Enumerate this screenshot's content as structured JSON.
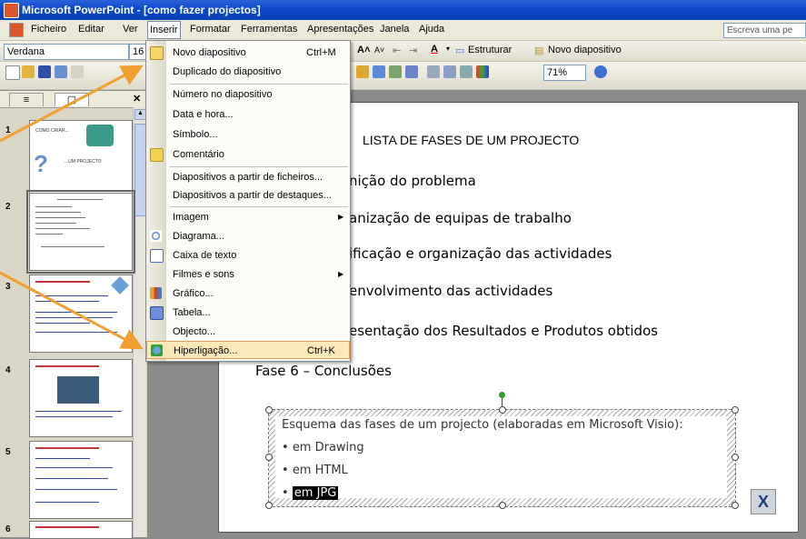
{
  "window": {
    "title": "Microsoft PowerPoint - [como fazer projectos]"
  },
  "menubar": {
    "items": [
      "Ficheiro",
      "Editar",
      "Ver",
      "Inserir",
      "Formatar",
      "Ferramentas",
      "Apresentações",
      "Janela",
      "Ajuda"
    ],
    "help_placeholder": "Escreva uma pe"
  },
  "format_toolbar": {
    "font": "Verdana",
    "size": "16",
    "structure_label": "Estruturar",
    "new_slide_label": "Novo diapositivo"
  },
  "standard_toolbar": {
    "zoom": "71%"
  },
  "slide_thumbnails": {
    "numbers": [
      "1",
      "2",
      "3",
      "4",
      "5",
      "6"
    ],
    "thumb1_title": "COMO CRIAR...",
    "thumb1_subtitle": "...UM PROJECTO"
  },
  "insert_menu": {
    "items": [
      {
        "label": "Novo diapositivo",
        "shortcut": "Ctrl+M"
      },
      {
        "label": "Duplicado do diapositivo",
        "shortcut": ""
      },
      {
        "label": "Número no diapositivo",
        "shortcut": ""
      },
      {
        "label": "Data e hora...",
        "shortcut": ""
      },
      {
        "label": "Símbolo...",
        "shortcut": ""
      },
      {
        "label": "Comentário",
        "shortcut": ""
      },
      {
        "label": "Diapositivos a partir de ficheiros...",
        "shortcut": ""
      },
      {
        "label": "Diapositivos a partir de destaques...",
        "shortcut": ""
      },
      {
        "label": "Imagem",
        "shortcut": ""
      },
      {
        "label": "Diagrama...",
        "shortcut": ""
      },
      {
        "label": "Caixa de texto",
        "shortcut": ""
      },
      {
        "label": "Filmes e sons",
        "shortcut": ""
      },
      {
        "label": "Gráfico...",
        "shortcut": ""
      },
      {
        "label": "Tabela...",
        "shortcut": ""
      },
      {
        "label": "Objecto...",
        "shortcut": ""
      },
      {
        "label": "Hiperligação...",
        "shortcut": "Ctrl+K"
      }
    ]
  },
  "slide": {
    "title": "LISTA DE FASES DE UM PROJECTO",
    "bullets": [
      "nição do problema",
      "anização de equipas de trabalho",
      "ificação  e organização das actividades",
      "envolvimento das actividades",
      "esentação dos Resultados e Produtos obtidos",
      "Fase 6 – Conclusões"
    ],
    "schema": {
      "heading": "Esquema das fases de um projecto (elaboradas em Microsoft Visio):",
      "items": [
        "em Drawing",
        "em HTML",
        "em JPG"
      ]
    },
    "close_button": "X"
  },
  "colors": {
    "titlebar": "#0a47c9",
    "menu_highlight": "#fbe8b8",
    "arrow": "#f0a030"
  }
}
